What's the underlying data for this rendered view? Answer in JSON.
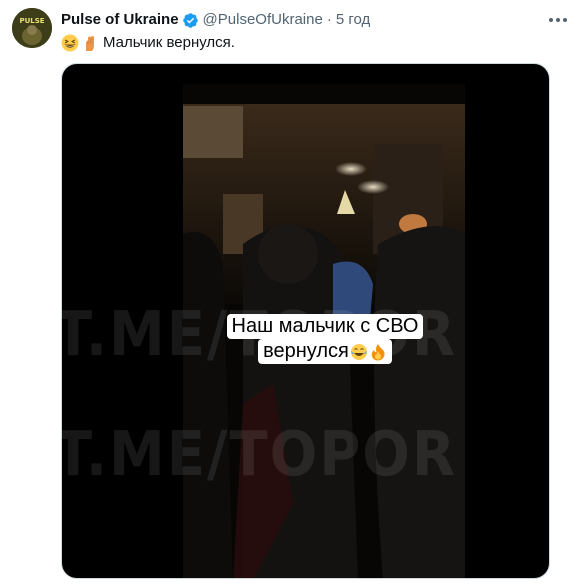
{
  "tweet": {
    "display_name": "Pulse of Ukraine",
    "handle": "@PulseOfUkraine",
    "separator": "·",
    "time": "5 год",
    "text": "Мальчик вернулся.",
    "avatar_icon": "pulse-of-ukraine-avatar",
    "verified_icon": "verified-badge-icon",
    "text_emojis": [
      "grinning-squinting-face-emoji",
      "raised-fist-emoji"
    ]
  },
  "video": {
    "caption_line1": "Наш мальчик с СВО",
    "caption_line2": "вернулся",
    "caption_emojis": [
      "face-with-tears-of-joy-emoji",
      "fire-emoji"
    ],
    "watermark_1": "T.ME/TOPOR",
    "watermark_2": "T.ME/TOPOR"
  },
  "colors": {
    "verified_blue": "#1d9bf0",
    "secondary_text": "#536471",
    "media_background": "#000000"
  }
}
